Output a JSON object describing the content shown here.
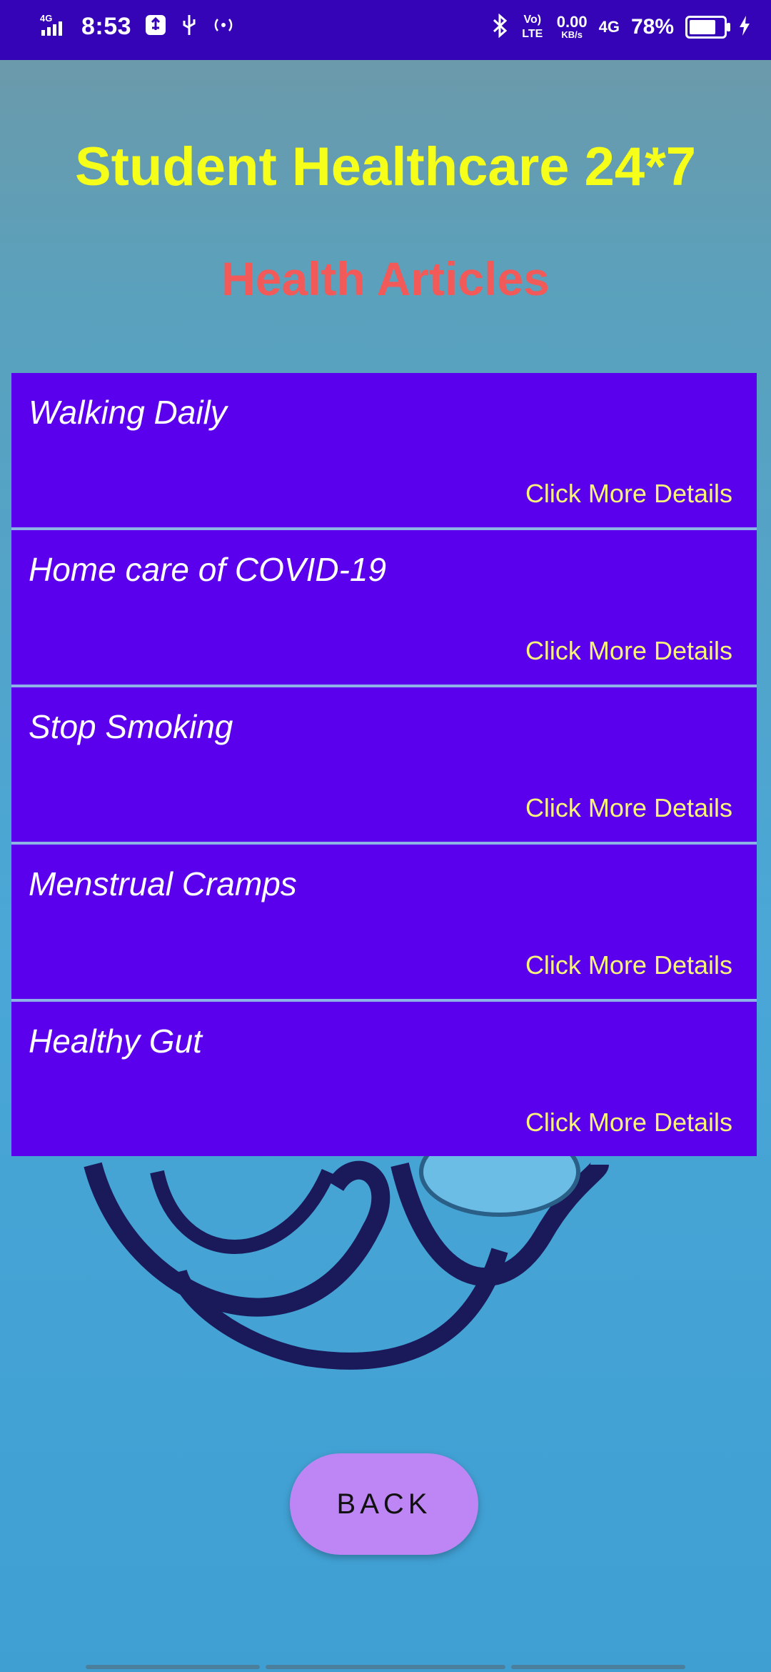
{
  "status_bar": {
    "network": "4G",
    "time": "8:53",
    "volte": "Vo) LTE",
    "speed": "0.00",
    "speed_unit": "KB/s",
    "network2": "4G",
    "battery": "78%",
    "battery_level": 0.78
  },
  "header": {
    "title": "Student Healthcare 24*7",
    "subtitle": "Health Articles"
  },
  "articles": [
    {
      "title": "Walking Daily",
      "link": "Click More Details"
    },
    {
      "title": "Home care of COVID-19",
      "link": "Click More Details"
    },
    {
      "title": "Stop Smoking",
      "link": "Click More Details"
    },
    {
      "title": "Menstrual Cramps",
      "link": "Click More Details"
    },
    {
      "title": "Healthy Gut",
      "link": "Click More Details"
    }
  ],
  "back_button": {
    "label": "BACK"
  },
  "colors": {
    "status_bar": "#3404b6",
    "title": "#f6ff1a",
    "subtitle": "#f25a5a",
    "card": "#5b00ec",
    "link": "#f8f37a",
    "button": "#bd86f4"
  },
  "icons": [
    "signal-icon",
    "usb-icon",
    "hotspot-icon",
    "bluetooth-icon",
    "battery-icon",
    "charging-icon"
  ]
}
